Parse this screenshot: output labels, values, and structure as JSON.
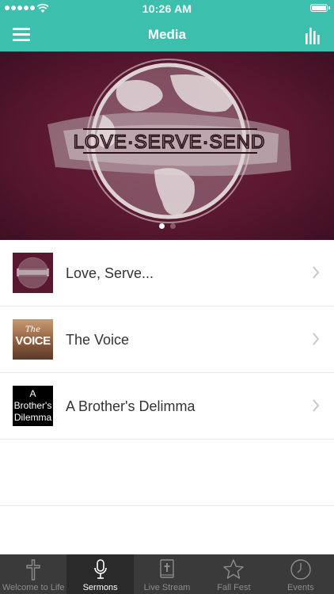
{
  "status_bar": {
    "time": "10:26 AM"
  },
  "navbar": {
    "title": "Media"
  },
  "banner": {
    "artwork_text": "LOVE·SERVE·SEND",
    "page_count": 2,
    "active_page": 0
  },
  "sermons": [
    {
      "title": "Love, Serve...",
      "thumb": "love-serve-send-artwork"
    },
    {
      "title": "The Voice",
      "thumb": "the-voice-artwork",
      "thumb_text_top": "The",
      "thumb_text_main": "VOICE"
    },
    {
      "title": "A Brother's Delimma",
      "thumb": "a-brothers-dilemma-artwork",
      "thumb_text": [
        "A",
        "Brother's",
        "Dilemma"
      ]
    }
  ],
  "tabs": [
    {
      "label": "Welcome to Life",
      "icon": "cross-icon"
    },
    {
      "label": "Sermons",
      "icon": "microphone-icon"
    },
    {
      "label": "Live Stream",
      "icon": "bible-icon"
    },
    {
      "label": "Fall Fest",
      "icon": "star-icon"
    },
    {
      "label": "Events",
      "icon": "clock-icon"
    }
  ],
  "active_tab": 1,
  "colors": {
    "accent": "#3cc0ad",
    "banner": "#5a1830",
    "tabbar": "#3a3a3a",
    "tab_active": "#2a2a2a"
  }
}
